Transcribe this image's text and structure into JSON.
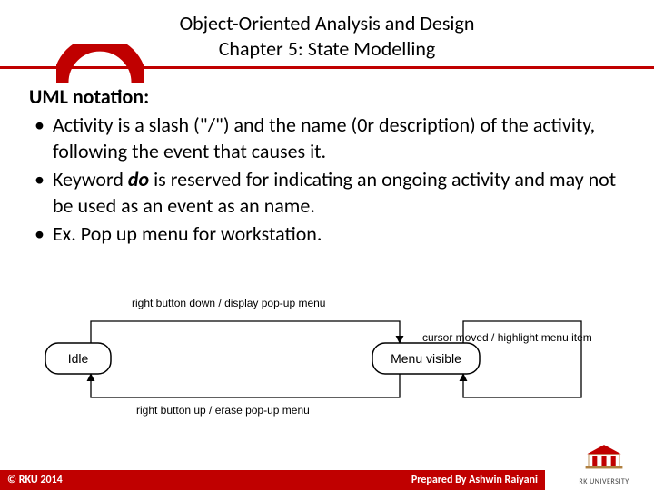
{
  "header": {
    "line1": "Object-Oriented Analysis and Design",
    "line2": "Chapter 5: State Modelling"
  },
  "content": {
    "heading": "UML notation:",
    "bullets": [
      {
        "pre": "Activity is a slash (\"/\") and the name (0r description) of the activity, following the event that causes it.",
        "kw": "",
        "post": ""
      },
      {
        "pre": "Keyword ",
        "kw": "do",
        "post": " is reserved for indicating an ongoing activity and may not be used as an event as an name."
      },
      {
        "pre": "Ex. Pop up menu for workstation.",
        "kw": "",
        "post": ""
      }
    ]
  },
  "diagram": {
    "state_idle": "Idle",
    "state_menu": "Menu visible",
    "t_down": "right button down / display pop-up menu",
    "t_up": "right button up / erase pop-up menu",
    "t_move": "cursor moved / highlight menu item"
  },
  "footer": {
    "copyright": "© RKU 2014",
    "prepared": "Prepared By Ashwin Raiyani",
    "logo_text": "RK UNIVERSITY"
  }
}
